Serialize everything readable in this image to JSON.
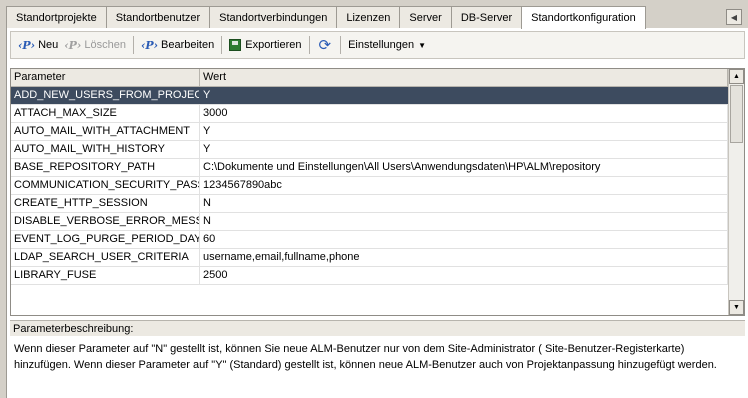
{
  "tabs": [
    {
      "label": "Standortprojekte",
      "active": false
    },
    {
      "label": "Standortbenutzer",
      "active": false
    },
    {
      "label": "Standortverbindungen",
      "active": false
    },
    {
      "label": "Lizenzen",
      "active": false
    },
    {
      "label": "Server",
      "active": false
    },
    {
      "label": "DB-Server",
      "active": false
    },
    {
      "label": "Standortkonfiguration",
      "active": true
    }
  ],
  "toolbar": {
    "new_label": "Neu",
    "delete_label": "Löschen",
    "edit_label": "Bearbeiten",
    "export_label": "Exportieren",
    "settings_label": "Einstellungen",
    "param_icon_glyph": "‹P›"
  },
  "grid": {
    "columns": [
      "Parameter",
      "Wert"
    ],
    "rows": [
      {
        "param": "ADD_NEW_USERS_FROM_PROJECT",
        "value": "Y",
        "selected": true
      },
      {
        "param": "ATTACH_MAX_SIZE",
        "value": "3000",
        "selected": false
      },
      {
        "param": "AUTO_MAIL_WITH_ATTACHMENT",
        "value": "Y",
        "selected": false
      },
      {
        "param": "AUTO_MAIL_WITH_HISTORY",
        "value": "Y",
        "selected": false
      },
      {
        "param": "BASE_REPOSITORY_PATH",
        "value": "C:\\Dokumente und Einstellungen\\All Users\\Anwendungsdaten\\HP\\ALM\\repository",
        "selected": false
      },
      {
        "param": "COMMUNICATION_SECURITY_PASS",
        "value": "1234567890abc",
        "selected": false
      },
      {
        "param": "CREATE_HTTP_SESSION",
        "value": "N",
        "selected": false
      },
      {
        "param": "DISABLE_VERBOSE_ERROR_MESS",
        "value": "N",
        "selected": false
      },
      {
        "param": "EVENT_LOG_PURGE_PERIOD_DAYS",
        "value": "60",
        "selected": false
      },
      {
        "param": "LDAP_SEARCH_USER_CRITERIA",
        "value": "username,email,fullname,phone",
        "selected": false
      },
      {
        "param": "LIBRARY_FUSE",
        "value": "2500",
        "selected": false
      }
    ]
  },
  "description": {
    "title": "Parameterbeschreibung:",
    "text": "Wenn dieser Parameter auf \"N\" gestellt ist, können Sie neue ALM-Benutzer nur von dem Site-Administrator ( Site-Benutzer-Registerkarte) hinzufügen. Wenn dieser Parameter auf \"Y\" (Standard) gestellt ist, können neue ALM-Benutzer auch von Projektanpassung hinzugefügt werden."
  },
  "colors": {
    "selected_row": "#3d4b5f",
    "chrome": "#d4d0c8",
    "icon_blue": "#2a5bb5"
  }
}
